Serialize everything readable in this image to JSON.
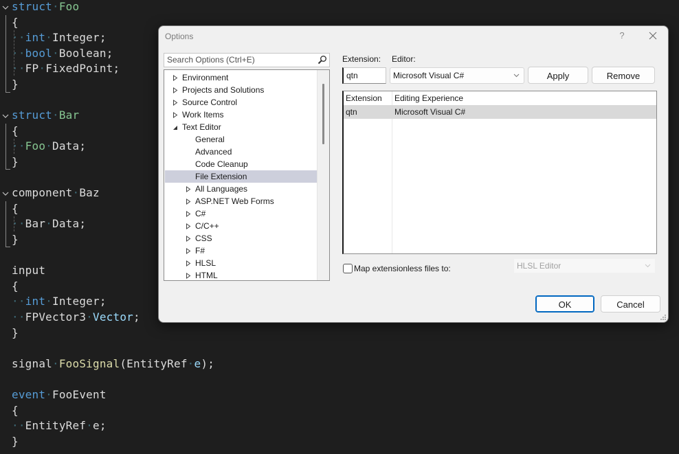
{
  "editor": {
    "lines": [
      {
        "tokens": [
          {
            "t": "struct",
            "c": "kw"
          },
          {
            "t": "·",
            "c": "ws"
          },
          {
            "t": "Foo",
            "c": "tg"
          }
        ]
      },
      {
        "tokens": [
          {
            "t": "{",
            "c": "plain"
          }
        ]
      },
      {
        "tokens": [
          {
            "t": "··",
            "c": "ws"
          },
          {
            "t": "int",
            "c": "kw"
          },
          {
            "t": "·",
            "c": "ws"
          },
          {
            "t": "Integer;",
            "c": "plain"
          }
        ]
      },
      {
        "tokens": [
          {
            "t": "··",
            "c": "ws"
          },
          {
            "t": "bool",
            "c": "kw"
          },
          {
            "t": "·",
            "c": "ws"
          },
          {
            "t": "Boolean;",
            "c": "plain"
          }
        ]
      },
      {
        "tokens": [
          {
            "t": "··",
            "c": "ws"
          },
          {
            "t": "FP",
            "c": "plain"
          },
          {
            "t": "·",
            "c": "ws"
          },
          {
            "t": "FixedPoint;",
            "c": "plain"
          }
        ]
      },
      {
        "tokens": [
          {
            "t": "}",
            "c": "plain"
          }
        ]
      },
      {
        "tokens": []
      },
      {
        "tokens": [
          {
            "t": "struct",
            "c": "kw"
          },
          {
            "t": "·",
            "c": "ws"
          },
          {
            "t": "Bar",
            "c": "tg"
          }
        ]
      },
      {
        "tokens": [
          {
            "t": "{",
            "c": "plain"
          }
        ]
      },
      {
        "tokens": [
          {
            "t": "··",
            "c": "ws"
          },
          {
            "t": "Foo",
            "c": "tg"
          },
          {
            "t": "·",
            "c": "ws"
          },
          {
            "t": "Data;",
            "c": "plain"
          }
        ]
      },
      {
        "tokens": [
          {
            "t": "}",
            "c": "plain"
          }
        ]
      },
      {
        "tokens": []
      },
      {
        "tokens": [
          {
            "t": "component",
            "c": "plain"
          },
          {
            "t": "·",
            "c": "ws"
          },
          {
            "t": "Baz",
            "c": "plain"
          }
        ]
      },
      {
        "tokens": [
          {
            "t": "{",
            "c": "plain"
          }
        ]
      },
      {
        "tokens": [
          {
            "t": "··",
            "c": "ws"
          },
          {
            "t": "Bar",
            "c": "plain"
          },
          {
            "t": "·",
            "c": "ws"
          },
          {
            "t": "Data;",
            "c": "plain"
          }
        ]
      },
      {
        "tokens": [
          {
            "t": "}",
            "c": "plain"
          }
        ]
      },
      {
        "tokens": []
      },
      {
        "tokens": [
          {
            "t": "input",
            "c": "plain"
          }
        ]
      },
      {
        "tokens": [
          {
            "t": "{",
            "c": "plain"
          }
        ]
      },
      {
        "tokens": [
          {
            "t": "··",
            "c": "ws"
          },
          {
            "t": "int",
            "c": "kw"
          },
          {
            "t": "·",
            "c": "ws"
          },
          {
            "t": "Integer;",
            "c": "plain"
          }
        ]
      },
      {
        "tokens": [
          {
            "t": "··",
            "c": "ws"
          },
          {
            "t": "FPVector3",
            "c": "plain"
          },
          {
            "t": "·",
            "c": "ws"
          },
          {
            "t": "Vector",
            "c": "pm"
          },
          {
            "t": ";",
            "c": "plain"
          }
        ]
      },
      {
        "tokens": [
          {
            "t": "}",
            "c": "plain"
          }
        ]
      },
      {
        "tokens": []
      },
      {
        "tokens": [
          {
            "t": "signal",
            "c": "plain"
          },
          {
            "t": "·",
            "c": "ws"
          },
          {
            "t": "FooSignal",
            "c": "fn"
          },
          {
            "t": "(EntityRef",
            "c": "plain"
          },
          {
            "t": "·",
            "c": "ws"
          },
          {
            "t": "e",
            "c": "pm"
          },
          {
            "t": ");",
            "c": "plain"
          }
        ]
      },
      {
        "tokens": []
      },
      {
        "tokens": [
          {
            "t": "event",
            "c": "kw"
          },
          {
            "t": "·",
            "c": "ws"
          },
          {
            "t": "FooEvent",
            "c": "plain"
          }
        ]
      },
      {
        "tokens": [
          {
            "t": "{",
            "c": "plain"
          }
        ]
      },
      {
        "tokens": [
          {
            "t": "··",
            "c": "ws"
          },
          {
            "t": "EntityRef",
            "c": "plain"
          },
          {
            "t": "·",
            "c": "ws"
          },
          {
            "t": "e;",
            "c": "plain"
          }
        ]
      },
      {
        "tokens": [
          {
            "t": "}",
            "c": "plain"
          }
        ]
      }
    ],
    "fold_icons": [
      "chevron-down-icon",
      "chevron-down-icon",
      "chevron-down-icon"
    ]
  },
  "dialog": {
    "title": "Options",
    "help_label": "?",
    "search": {
      "placeholder": "Search Options (Ctrl+E)",
      "value": ""
    },
    "tree": [
      {
        "label": "Environment",
        "level": 0,
        "state": "collapsed"
      },
      {
        "label": "Projects and Solutions",
        "level": 0,
        "state": "collapsed"
      },
      {
        "label": "Source Control",
        "level": 0,
        "state": "collapsed"
      },
      {
        "label": "Work Items",
        "level": 0,
        "state": "collapsed"
      },
      {
        "label": "Text Editor",
        "level": 0,
        "state": "expanded"
      },
      {
        "label": "General",
        "level": 1,
        "state": "leaf"
      },
      {
        "label": "Advanced",
        "level": 1,
        "state": "leaf"
      },
      {
        "label": "Code Cleanup",
        "level": 1,
        "state": "leaf"
      },
      {
        "label": "File Extension",
        "level": 1,
        "state": "leaf",
        "selected": true
      },
      {
        "label": "All Languages",
        "level": 1,
        "state": "collapsed"
      },
      {
        "label": "ASP.NET Web Forms",
        "level": 1,
        "state": "collapsed"
      },
      {
        "label": "C#",
        "level": 1,
        "state": "collapsed"
      },
      {
        "label": "C/C++",
        "level": 1,
        "state": "collapsed"
      },
      {
        "label": "CSS",
        "level": 1,
        "state": "collapsed"
      },
      {
        "label": "F#",
        "level": 1,
        "state": "collapsed"
      },
      {
        "label": "HLSL",
        "level": 1,
        "state": "collapsed"
      },
      {
        "label": "HTML",
        "level": 1,
        "state": "collapsed"
      }
    ],
    "extension_label": "Extension:",
    "extension_value": "qtn",
    "editor_label": "Editor:",
    "editor_value": "Microsoft Visual C#",
    "apply_label": "Apply",
    "remove_label": "Remove",
    "mapping_table": {
      "columns": [
        "Extension",
        "Editing Experience"
      ],
      "rows": [
        {
          "extension": "qtn",
          "experience": "Microsoft Visual C#",
          "selected": true
        }
      ]
    },
    "map_extensionless": {
      "label": "Map extensionless files to:",
      "checked": false,
      "value": "HLSL Editor",
      "enabled": false
    },
    "ok_label": "OK",
    "cancel_label": "Cancel"
  }
}
